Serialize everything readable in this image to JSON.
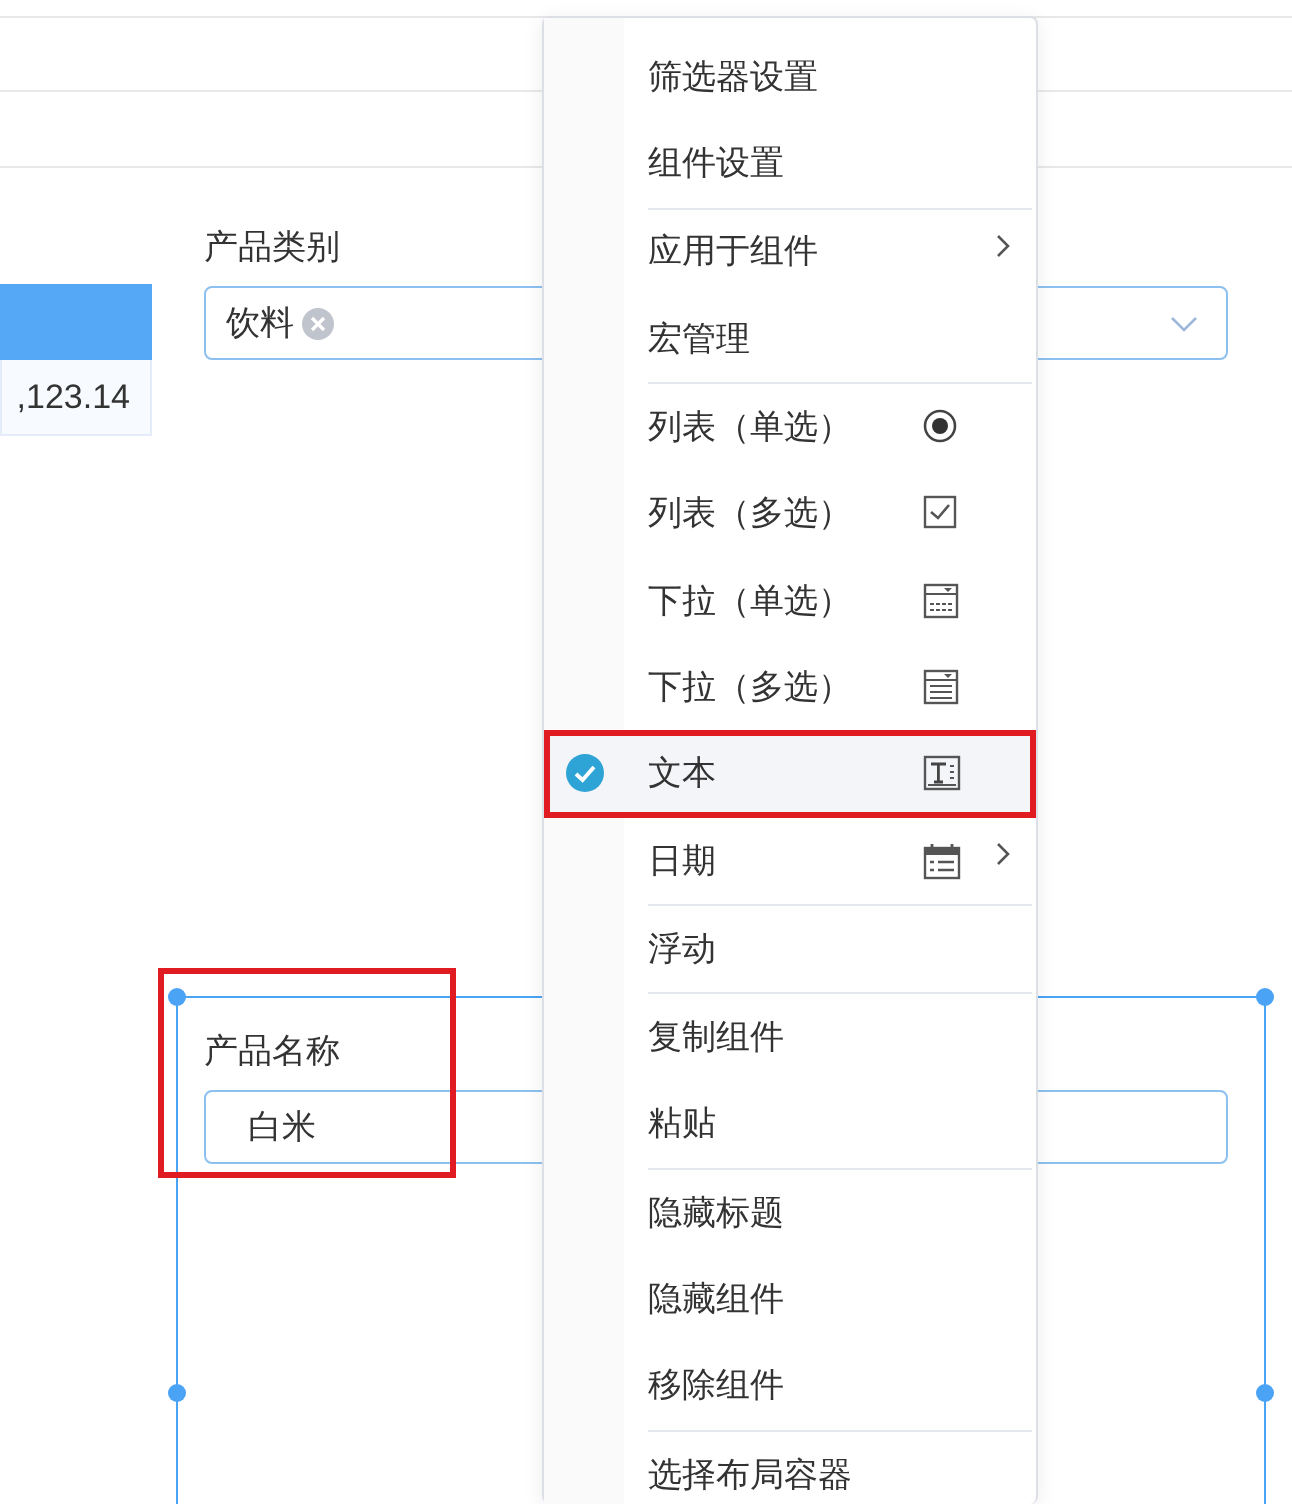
{
  "left_table": {
    "cell": ",123.14"
  },
  "filters": [
    {
      "kind": "tags",
      "label": "产品类别",
      "tags": [
        "饮料"
      ],
      "selected": false,
      "annotated": false
    },
    {
      "kind": "text",
      "label": "产品名称",
      "value": "白米",
      "selected": true,
      "annotated": true
    }
  ],
  "context_menu": {
    "groups": [
      [
        {
          "label": "筛选器设置",
          "kind": "plain",
          "checked": false,
          "submenu": false,
          "annotated": false
        },
        {
          "label": "组件设置",
          "kind": "plain",
          "checked": false,
          "submenu": false,
          "annotated": false
        }
      ],
      [
        {
          "label": "应用于组件",
          "kind": "plain",
          "checked": false,
          "submenu": true,
          "annotated": false
        },
        {
          "label": "宏管理",
          "kind": "plain",
          "checked": false,
          "submenu": false,
          "annotated": false
        }
      ],
      [
        {
          "label": "列表（单选）",
          "kind": "radio",
          "checked": false,
          "submenu": false,
          "annotated": false
        },
        {
          "label": "列表（多选）",
          "kind": "checkbox",
          "checked": false,
          "submenu": false,
          "annotated": false
        },
        {
          "label": "下拉（单选）",
          "kind": "dropdown",
          "checked": false,
          "submenu": false,
          "annotated": false
        },
        {
          "label": "下拉（多选）",
          "kind": "dropdown-multi",
          "checked": false,
          "submenu": false,
          "annotated": false
        },
        {
          "label": "文本",
          "kind": "text",
          "checked": true,
          "submenu": false,
          "annotated": true
        },
        {
          "label": "日期",
          "kind": "date",
          "checked": false,
          "submenu": true,
          "annotated": false
        }
      ],
      [
        {
          "label": "浮动",
          "kind": "plain",
          "checked": false,
          "submenu": false,
          "annotated": false
        }
      ],
      [
        {
          "label": "复制组件",
          "kind": "plain",
          "checked": false,
          "submenu": false,
          "annotated": false
        },
        {
          "label": "粘贴",
          "kind": "plain",
          "checked": false,
          "submenu": false,
          "annotated": false
        }
      ],
      [
        {
          "label": "隐藏标题",
          "kind": "plain",
          "checked": false,
          "submenu": false,
          "annotated": false
        },
        {
          "label": "隐藏组件",
          "kind": "plain",
          "checked": false,
          "submenu": false,
          "annotated": false
        },
        {
          "label": "移除组件",
          "kind": "plain",
          "checked": false,
          "submenu": false,
          "annotated": false
        }
      ],
      [
        {
          "label": "选择布局容器",
          "kind": "plain",
          "checked": false,
          "submenu": false,
          "annotated": false
        }
      ]
    ]
  }
}
